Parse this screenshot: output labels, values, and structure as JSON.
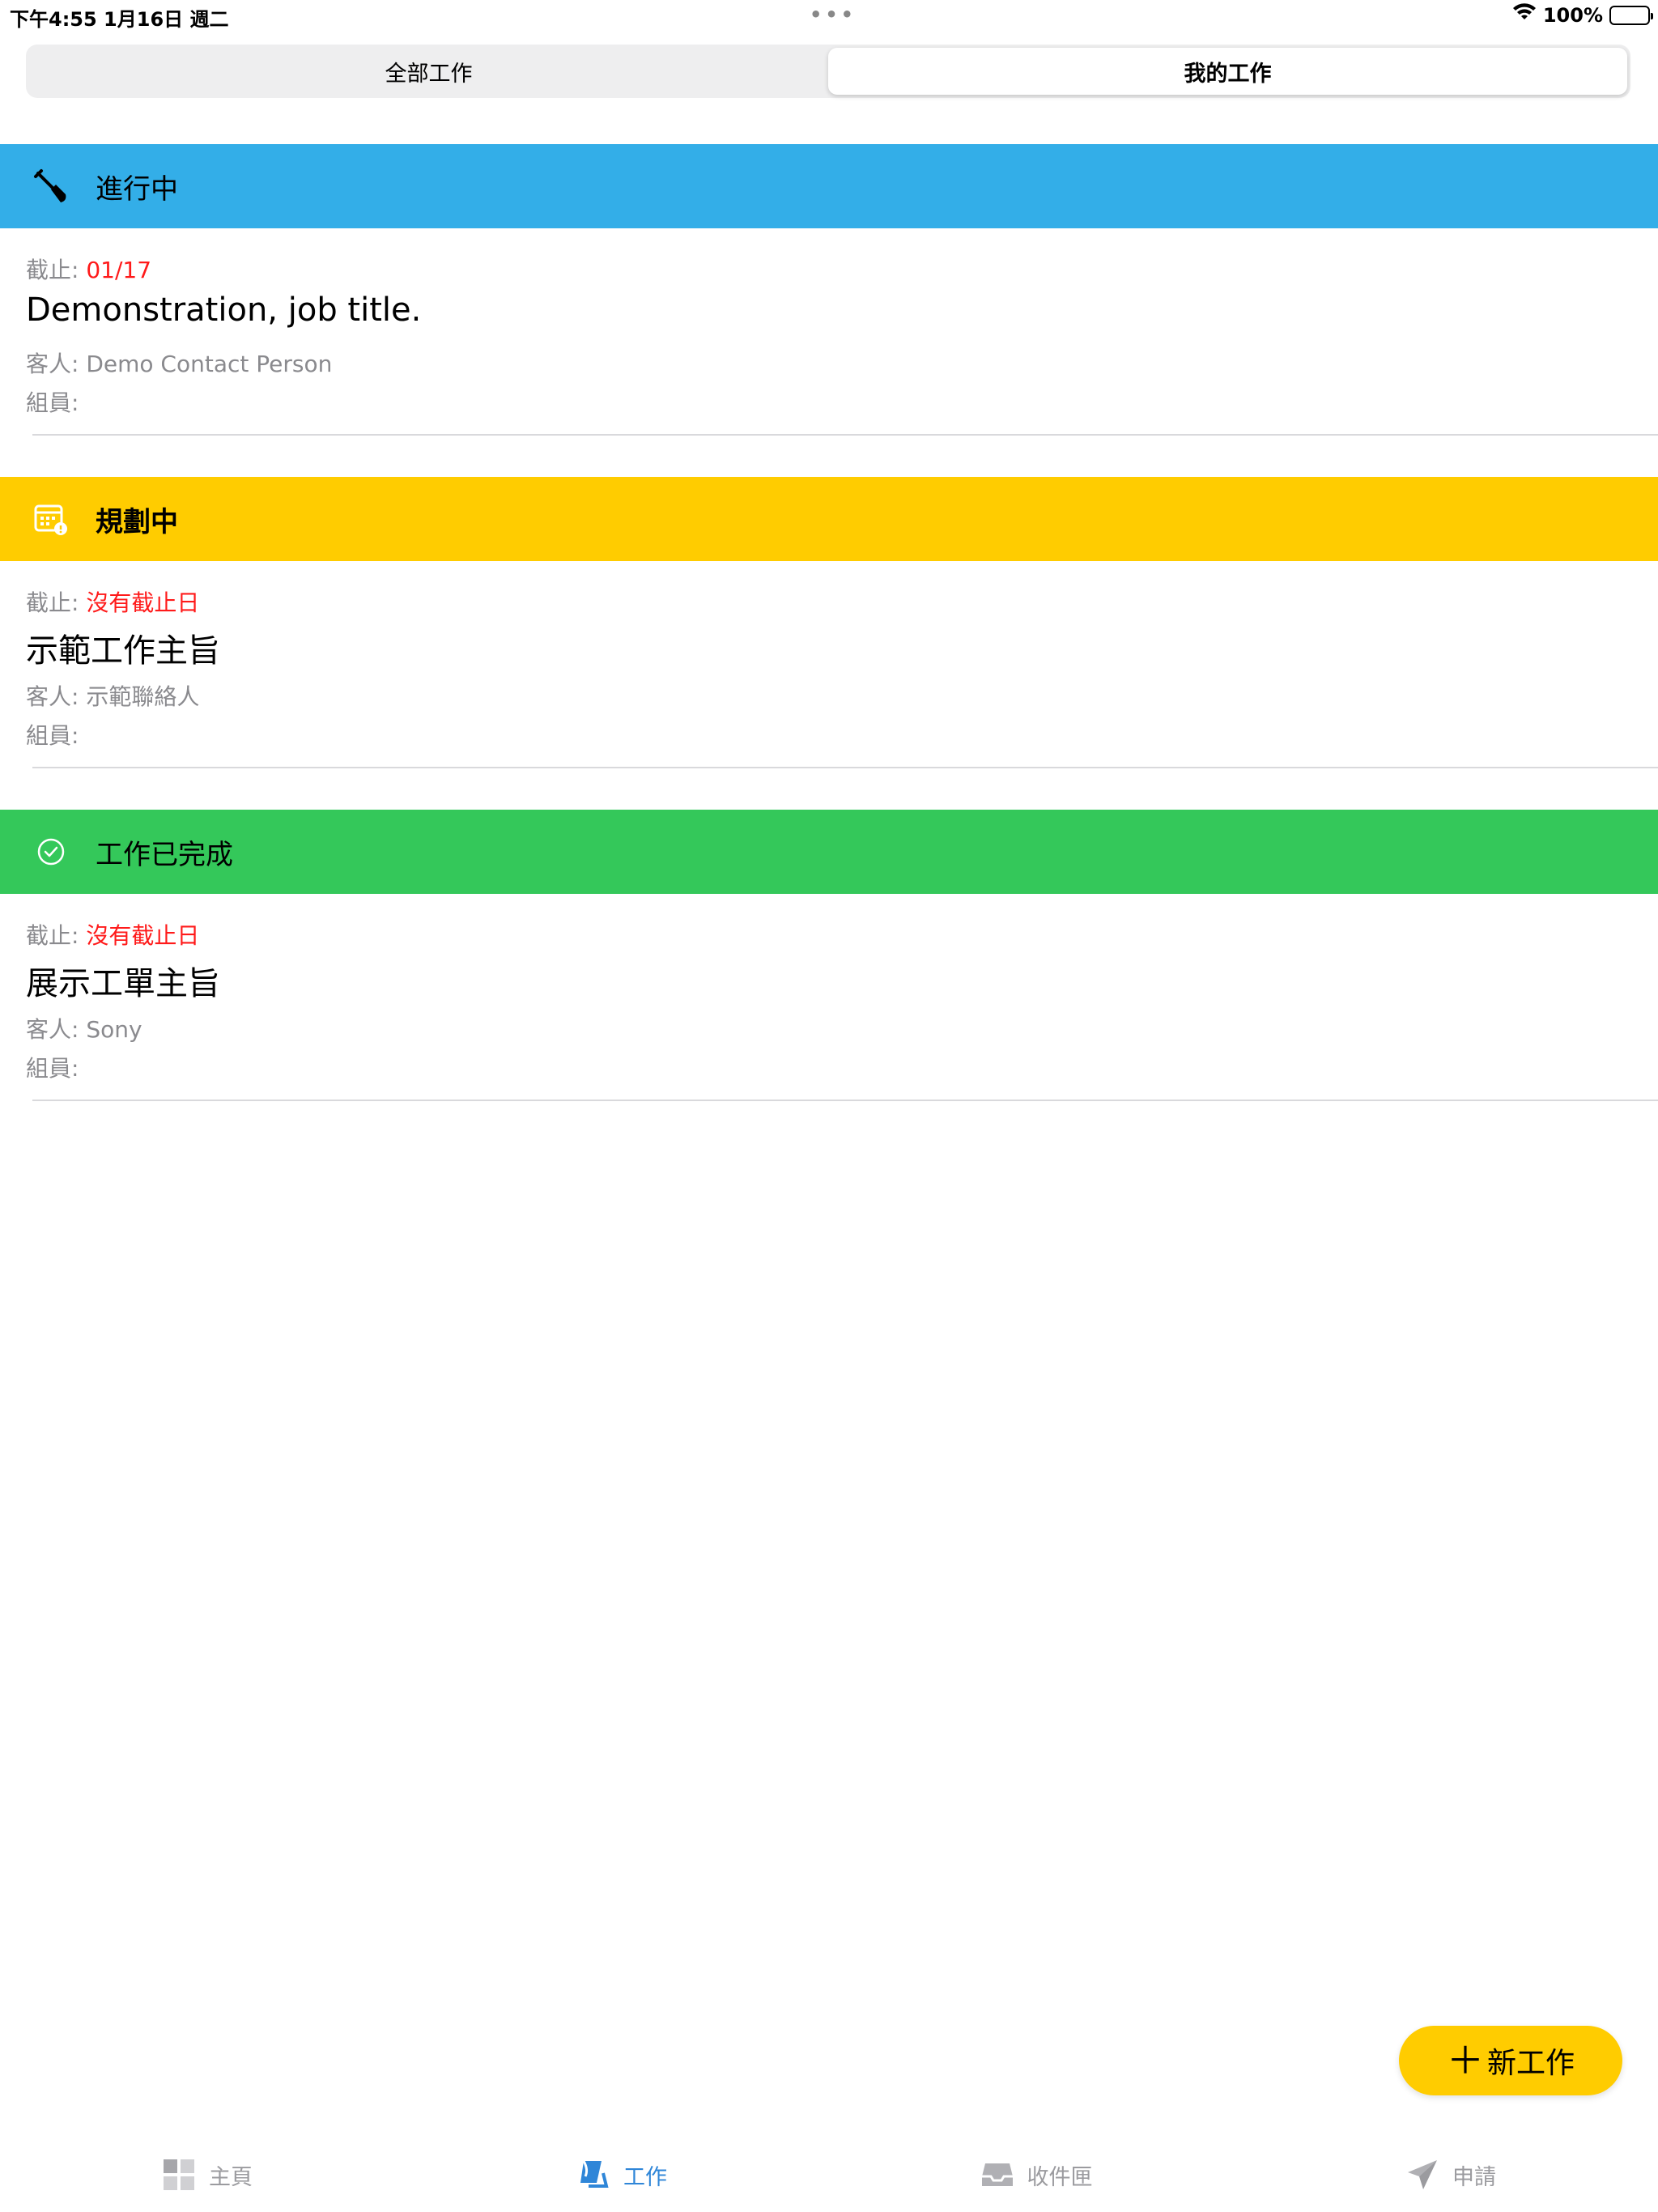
{
  "status_bar": {
    "time_date": "下午4:55   1月16日 週二",
    "center": "•••",
    "battery": "100%"
  },
  "segmented": {
    "all_jobs": "全部工作",
    "my_jobs": "我的工作"
  },
  "sections": [
    {
      "title": "進行中",
      "color": "#33aee8",
      "icon": "shovel-icon",
      "job": {
        "due_label": "截止: ",
        "due_value": "01/17",
        "title": "Demonstration, job title.",
        "client": "客人: Demo Contact Person",
        "members": "組員:"
      }
    },
    {
      "title": "規劃中",
      "color": "#ffcc00",
      "icon": "calendar-alert-icon",
      "job": {
        "due_label": "截止: ",
        "due_value": "沒有截止日",
        "title": "示範工作主旨",
        "client": "客人: 示範聯絡人",
        "members": "組員:"
      }
    },
    {
      "title": "工作已完成",
      "color": "#34c85a",
      "icon": "check-circle-icon",
      "job": {
        "due_label": "截止: ",
        "due_value": "沒有截止日",
        "title": "展示工單主旨",
        "client": "客人: Sony",
        "members": "組員:"
      }
    }
  ],
  "fab": {
    "plus": "＋",
    "label": "新工作"
  },
  "tabbar": {
    "home": "主頁",
    "jobs": "工作",
    "inbox": "收件匣",
    "request": "申請",
    "active_color": "#2f86d8"
  }
}
